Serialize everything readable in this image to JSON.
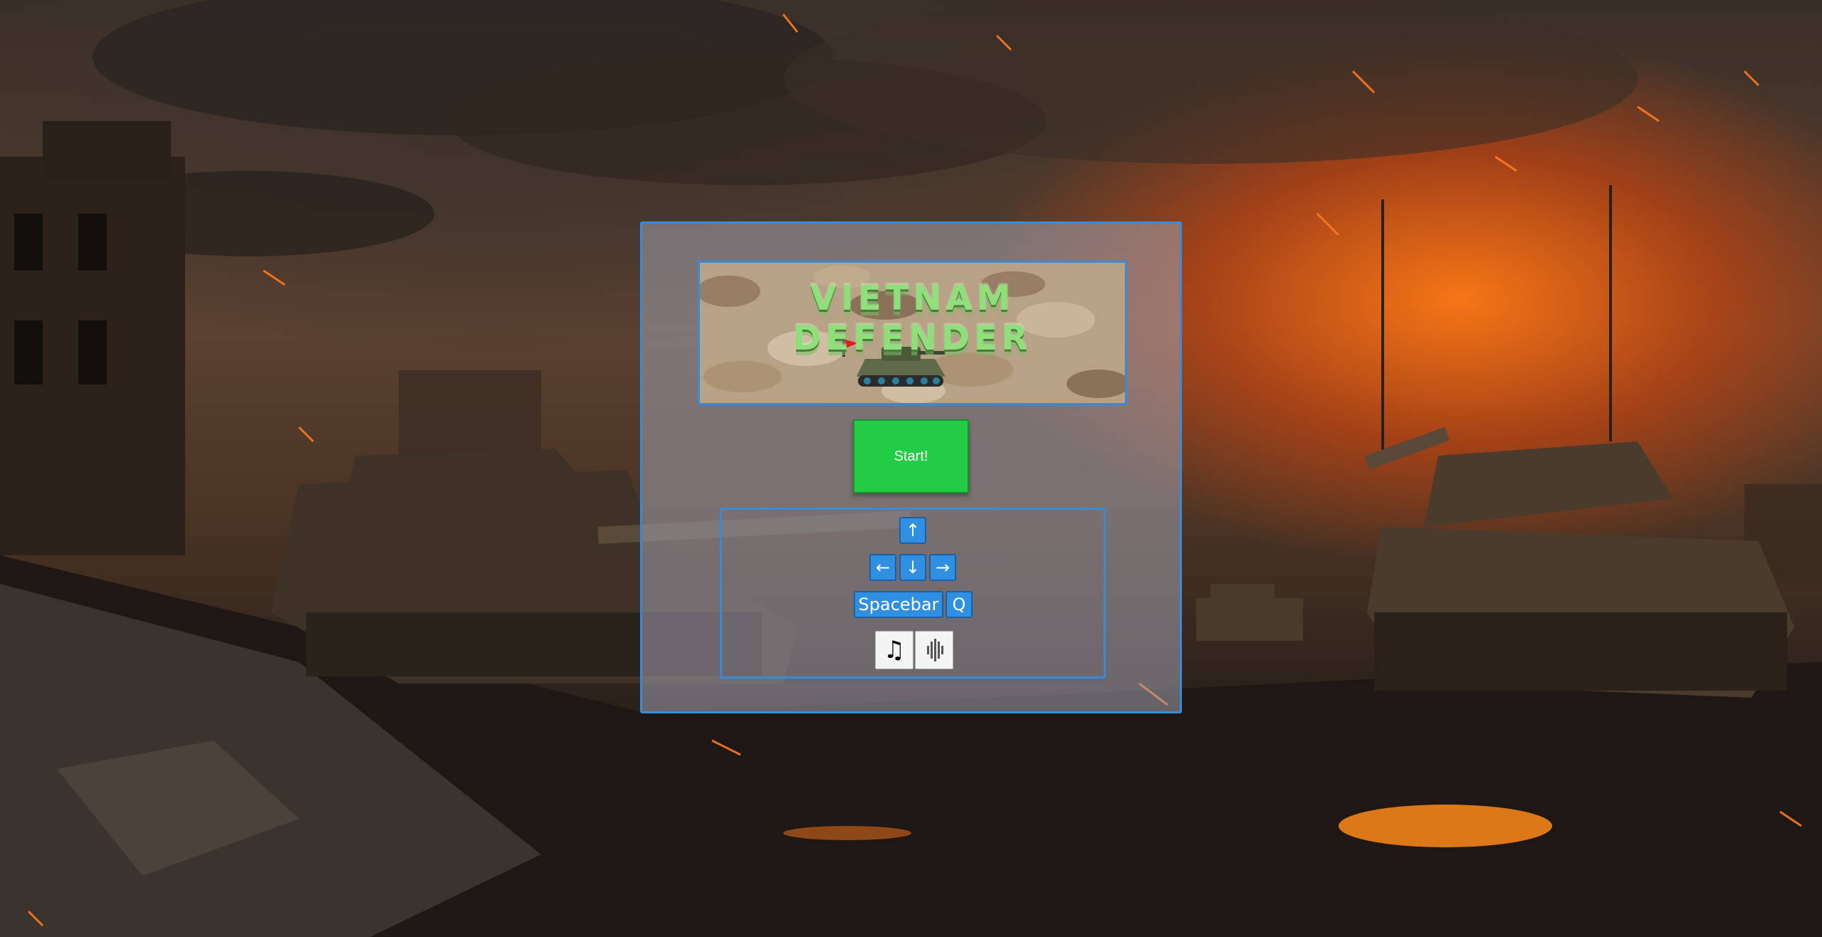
{
  "game": {
    "title": "VIETNAM DEFENDER",
    "start_label": "Start!",
    "controls": {
      "up": "↑",
      "left": "←",
      "down": "↓",
      "right": "→",
      "fire": "Spacebar",
      "quit": "Q"
    },
    "sound": {
      "music_icon": "♫",
      "effects_icon": "sound-wave-icon"
    }
  },
  "colors": {
    "panel_border": "#3a8ad6",
    "start_button": "#22cc44",
    "key_button": "#2f8fe0",
    "title_text": "#8fe07a"
  }
}
